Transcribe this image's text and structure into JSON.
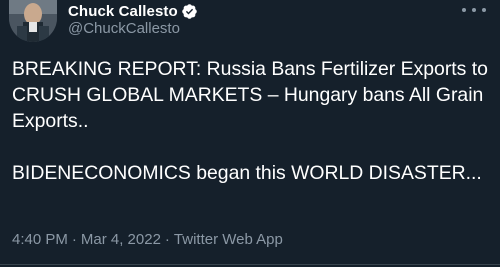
{
  "author": {
    "display_name": "Chuck Callesto",
    "handle": "@ChuckCallesto",
    "verified": true
  },
  "tweet": {
    "paragraphs": [
      "BREAKING REPORT: Russia Bans Fertilizer Exports to CRUSH GLOBAL MARKETS – Hungary bans All Grain Exports..",
      "BIDENECONOMICS began this WORLD DISASTER..."
    ]
  },
  "meta": {
    "time": "4:40 PM",
    "separator": "·",
    "date": "Mar 4, 2022",
    "source": "Twitter Web App"
  },
  "icons": {
    "verified": "verified-badge-icon",
    "more": "more-options-icon"
  },
  "colors": {
    "background": "#15202b",
    "text": "#ffffff",
    "secondary_text": "#8b98a5",
    "verified_badge": "#ffffff"
  }
}
